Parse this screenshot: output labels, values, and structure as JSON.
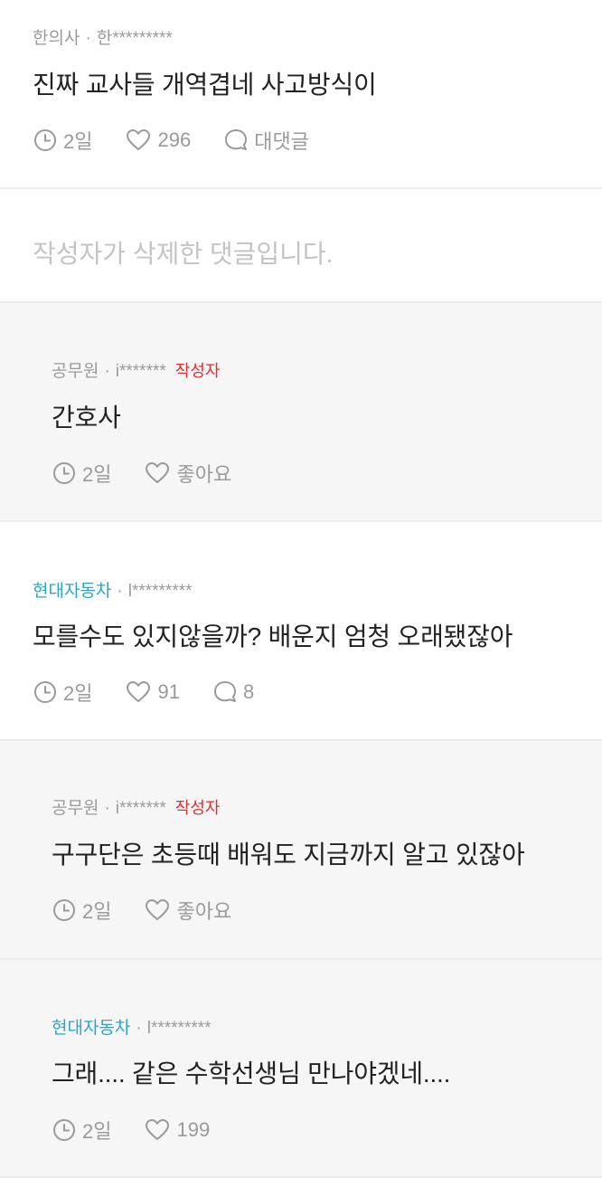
{
  "comments": [
    {
      "company": "한의사",
      "user": "한*********",
      "text": "진짜 교사들 개역겹네 사고방식이",
      "time": "2일",
      "likes": "296",
      "reply": "대댓글"
    },
    {
      "deleted_text": "작성자가 삭제한 댓글입니다."
    },
    {
      "company": "공무원",
      "user": "i*******",
      "author_tag": "작성자",
      "text": "간호사",
      "time": "2일",
      "likes": "좋아요"
    },
    {
      "company": "현대자동차",
      "user": "l*********",
      "text": "모를수도 있지않을까? 배운지 엄청 오래됐잖아",
      "time": "2일",
      "likes": "91",
      "reply": "8"
    },
    {
      "company": "공무원",
      "user": "i*******",
      "author_tag": "작성자",
      "text": "구구단은 초등때 배워도 지금까지 알고 있잖아",
      "time": "2일",
      "likes": "좋아요"
    },
    {
      "company": "현대자동차",
      "user": "l*********",
      "text": "그래.... 같은 수학선생님 만나야겠네....",
      "time": "2일",
      "likes": "199"
    }
  ],
  "icons": {
    "time": "clock-icon",
    "like": "heart-icon",
    "reply": "speech-bubble-icon"
  },
  "colors": {
    "company_highlight": "#2aa6c6",
    "author_tag": "#e02d2d",
    "reply_bg": "#f6f6f6"
  }
}
